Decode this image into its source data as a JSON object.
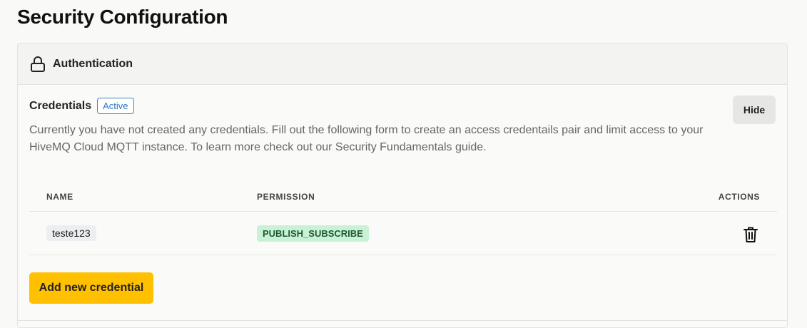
{
  "page": {
    "title": "Security Configuration"
  },
  "auth_panel": {
    "title": "Authentication",
    "icon": "lock-icon"
  },
  "credentials": {
    "title": "Credentials",
    "status_badge": "Active",
    "hide_label": "Hide",
    "description": "Currently you have not created any credentials. Fill out the following form to create an access credentails pair and limit access to your HiveMQ Cloud MQTT instance. To learn more check out our Security Fundamentals guide.",
    "table": {
      "headers": {
        "name": "NAME",
        "permission": "PERMISSION",
        "actions": "ACTIONS"
      },
      "rows": [
        {
          "name": "teste123",
          "permission": "PUBLISH_SUBSCRIBE",
          "action_icon": "trash-icon"
        }
      ]
    },
    "add_label": "Add new credential"
  },
  "colors": {
    "accent_button": "#ffc000",
    "badge_active": "#2f78bb",
    "permission_chip": "#c9f1d6"
  }
}
